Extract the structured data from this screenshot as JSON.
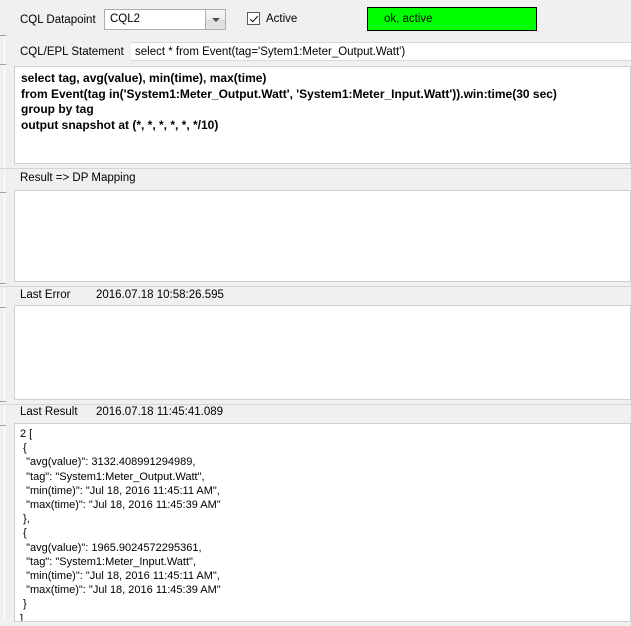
{
  "form": {
    "datapoint_label": "CQL Datapoint",
    "datapoint_value": "CQL2",
    "datapoint_options": [
      "CQL2"
    ],
    "dropdown_icon": "chevron-down-icon",
    "active_label": "Active",
    "active_checked": true,
    "check_icon": "checkmark-icon",
    "status_text": "ok, active",
    "status_color": "#00ff00",
    "statement_label": "CQL/EPL Statement",
    "statement_value": "select * from Event(tag='Sytem1:Meter_Output.Watt')",
    "statement_placeholder": ""
  },
  "editor": {
    "text": "select tag, avg(value), min(time), max(time)\nfrom Event(tag in('System1:Meter_Output.Watt', 'System1:Meter_Input.Watt')).win:time(30 sec)\ngroup by tag\noutput snapshot at (*, *, *, *, *, */10)"
  },
  "mapping": {
    "label": "Result => DP Mapping",
    "text": ""
  },
  "last_error": {
    "label": "Last Error",
    "timestamp": "2016.07.18 10:58:26.595",
    "text": ""
  },
  "last_result": {
    "label": "Last Result",
    "timestamp": "2016.07.18 11:45:41.089",
    "text": "2 [\n {\n  \"avg(value)\": 3132.408991294989,\n  \"tag\": \"System1:Meter_Output.Watt\",\n  \"min(time)\": \"Jul 18, 2016 11:45:11 AM\",\n  \"max(time)\": \"Jul 18, 2016 11:45:39 AM\"\n },\n {\n  \"avg(value)\": 1965.9024572295361,\n  \"tag\": \"System1:Meter_Input.Watt\",\n  \"min(time)\": \"Jul 18, 2016 11:45:11 AM\",\n  \"max(time)\": \"Jul 18, 2016 11:45:39 AM\"\n }\n]"
  }
}
